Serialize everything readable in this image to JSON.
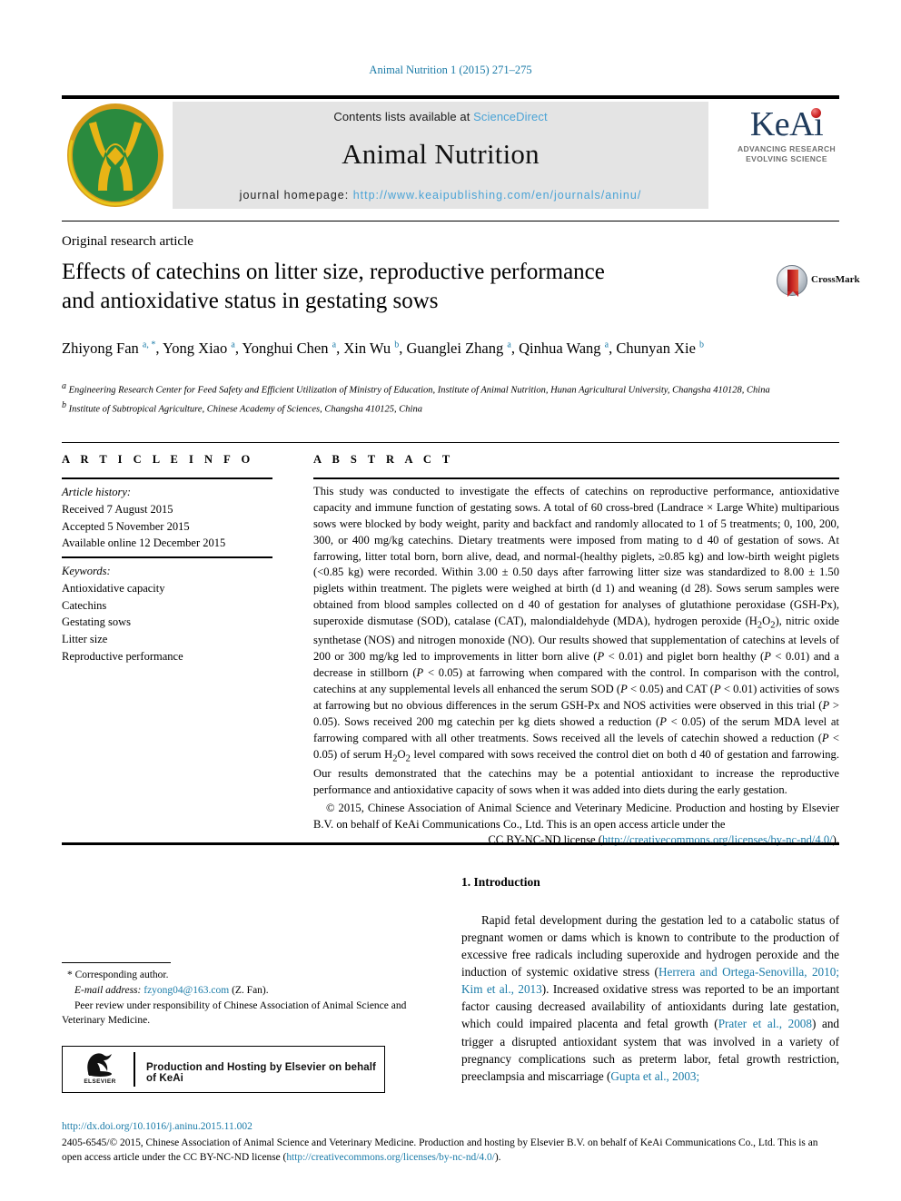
{
  "running_head": "Animal Nutrition 1 (2015) 271–275",
  "banner": {
    "contents_prefix": "Contents lists available at ",
    "sciencedirect": "ScienceDirect",
    "journal_name": "Animal Nutrition",
    "homepage_prefix": "journal homepage: ",
    "homepage_url": "http://www.keaipublishing.com/en/journals/aninu/",
    "keai_logo_text": "KeAi",
    "keai_tagline_line1": "ADVANCING RESEARCH",
    "keai_tagline_line2": "EVOLVING SCIENCE",
    "journal_logo_name": "animal-nutrition-journal-logo"
  },
  "article": {
    "type": "Original research article",
    "title_line1": "Effects of catechins on litter size, reproductive performance",
    "title_line2": "and antioxidative status in gestating sows",
    "crossmark_label": "CrossMark",
    "authors_html": "Zhiyong Fan <sup class=\"sup\">a, *</sup>, Yong Xiao <sup class=\"sup\">a</sup>, Yonghui Chen <sup class=\"sup\">a</sup>, Xin Wu <sup class=\"sup\">b</sup>, Guanglei Zhang <sup class=\"sup\">a</sup>, Qinhua Wang <sup class=\"sup\">a</sup>, Chunyan Xie <sup class=\"sup\">b</sup>",
    "affiliation_a": "Engineering Research Center for Feed Safety and Efficient Utilization of Ministry of Education, Institute of Animal Nutrition, Hunan Agricultural University, Changsha 410128, China",
    "affiliation_b": "Institute of Subtropical Agriculture, Chinese Academy of Sciences, Changsha 410125, China"
  },
  "article_info": {
    "heading": "A R T I C L E  I N F O",
    "history_label": "Article history:",
    "received": "Received 7 August 2015",
    "accepted": "Accepted 5 November 2015",
    "available": "Available online 12 December 2015",
    "keywords_label": "Keywords:",
    "keywords": [
      "Antioxidative capacity",
      "Catechins",
      "Gestating sows",
      "Litter size",
      "Reproductive performance"
    ]
  },
  "abstract": {
    "heading": "A B S T R A C T",
    "body": "This study was conducted to investigate the effects of catechins on reproductive performance, antioxidative capacity and immune function of gestating sows. A total of 60 cross-bred (Landrace × Large White) multiparious sows were blocked by body weight, parity and backfact and randomly allocated to 1 of 5 treatments; 0, 100, 200, 300, or 400 mg/kg catechins. Dietary treatments were imposed from mating to d 40 of gestation of sows. At farrowing, litter total born, born alive, dead, and normal-(healthy piglets, ≥0.85 kg) and low-birth weight piglets (<0.85 kg) were recorded. Within 3.00 ± 0.50 days after farrowing litter size was standardized to 8.00 ± 1.50 piglets within treatment. The piglets were weighed at birth (d 1) and weaning (d 28). Sows serum samples were obtained from blood samples collected on d 40 of gestation for analyses of glutathione peroxidase (GSH-Px), superoxide dismutase (SOD), catalase (CAT), malondialdehyde (MDA), hydrogen peroxide (H2O2), nitric oxide synthetase (NOS) and nitrogen monoxide (NO). Our results showed that supplementation of catechins at levels of 200 or 300 mg/kg led to improvements in litter born alive (P < 0.01) and piglet born healthy (P < 0.01) and a decrease in stillborn (P < 0.05) at farrowing when compared with the control. In comparison with the control, catechins at any supplemental levels all enhanced the serum SOD (P < 0.05) and CAT (P < 0.01) activities of sows at farrowing but no obvious differences in the serum GSH-Px and NOS activities were observed in this trial (P > 0.05). Sows received 200 mg catechin per kg diets showed a reduction (P < 0.05) of the serum MDA level at farrowing compared with all other treatments. Sows received all the levels of catechin showed a reduction (P < 0.05) of serum H2O2 level compared with sows received the control diet on both d 40 of gestation and farrowing. Our results demonstrated that the catechins may be a potential antioxidant to increase the reproductive performance and antioxidative capacity of sows when it was added into diets during the early gestation.",
    "copyright": "© 2015, Chinese Association of Animal Science and Veterinary Medicine. Production and hosting by Elsevier B.V. on behalf of KeAi Communications Co., Ltd. This is an open access article under the",
    "license_prefix": "CC BY-NC-ND license (",
    "license_url": "http://creativecommons.org/licenses/by-nc-nd/4.0/",
    "license_suffix": ")."
  },
  "introduction": {
    "number_title": "1.  Introduction",
    "paragraph": "Rapid fetal development during the gestation led to a catabolic status of pregnant women or dams which is known to contribute to the production of excessive free radicals including superoxide and hydrogen peroxide and the induction of systemic oxidative stress (Herrera and Ortega-Senovilla, 2010; Kim et al., 2013). Increased oxidative stress was reported to be an important factor causing decreased availability of antioxidants during late gestation, which could impaired placenta and fetal growth (Prater et al., 2008) and trigger a disrupted antioxidant system that was involved in a variety of pregnancy complications such as preterm labor, fetal growth restriction, preeclampsia and miscarriage (Gupta et al., 2003;"
  },
  "footnotes": {
    "corresponding": "* Corresponding author.",
    "email_label": "E-mail address:",
    "email": "fzyong04@163.com",
    "email_suffix": "(Z. Fan).",
    "peer_review": "Peer review under responsibility of Chinese Association of Animal Science and Veterinary Medicine."
  },
  "production_box": {
    "elsevier_label": "ELSEVIER",
    "text": "Production and Hosting by Elsevier on behalf of KeAi"
  },
  "footer": {
    "doi": "http://dx.doi.org/10.1016/j.aninu.2015.11.002",
    "issn_text": "2405-6545/© 2015, Chinese Association of Animal Science and Veterinary Medicine. Production and hosting by Elsevier B.V. on behalf of KeAi Communications Co., Ltd. This is an open access article under the CC BY-NC-ND license (",
    "issn_url": "http://creativecommons.org/licenses/by-nc-nd/4.0/",
    "issn_suffix": ")."
  },
  "colors": {
    "link": "#1a7ba8",
    "sciencedirect": "#4aa3d6",
    "keai_navy": "#1f3b5c",
    "logo_green": "#2a8a3e",
    "logo_gold": "#e8b416",
    "banner_grey": "#e4e4e4"
  }
}
